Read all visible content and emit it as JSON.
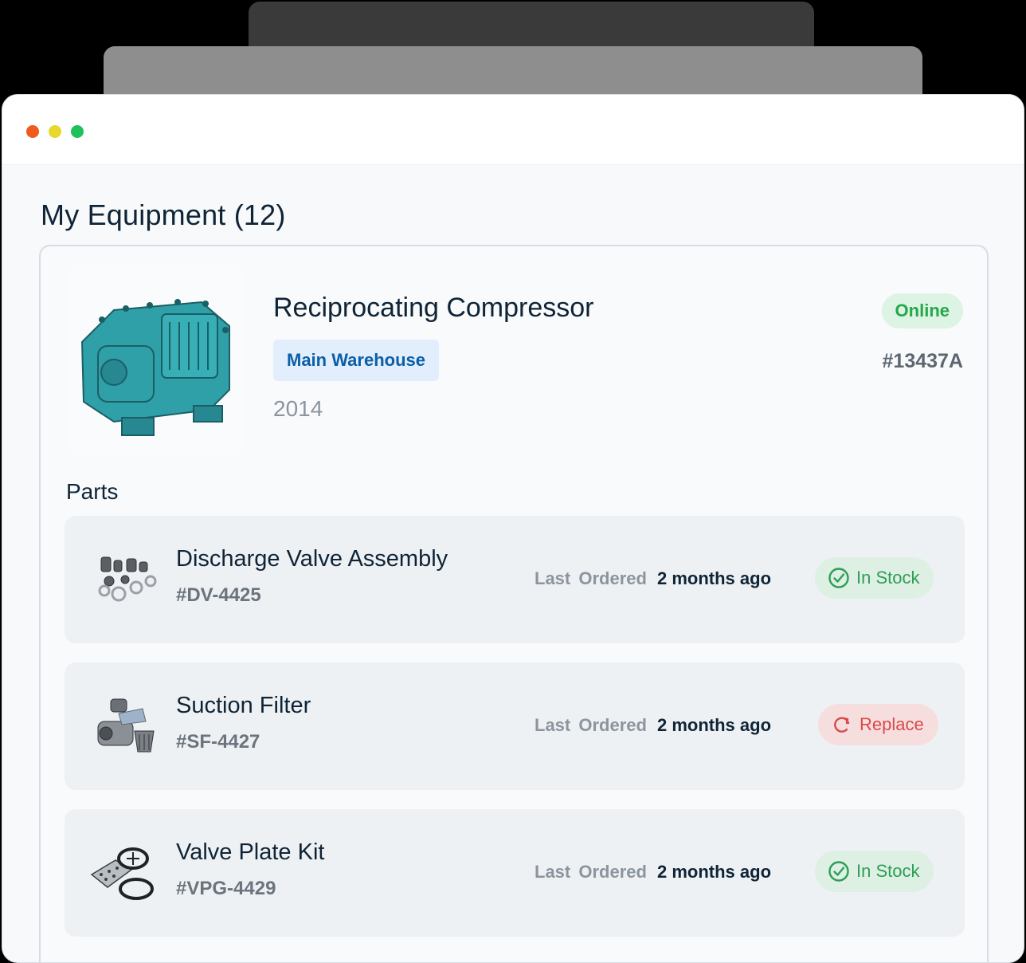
{
  "page": {
    "heading": "My Equipment (12)"
  },
  "equipment": {
    "name": "Reciprocating Compressor",
    "location": "Main Warehouse",
    "year": "2014",
    "status": "Online",
    "id": "#13437A",
    "image_icon": "compressor-image",
    "image_color": "#2f9fa8"
  },
  "parts_section": {
    "title": "Parts",
    "last_ordered_label": "Last Ordered",
    "items": [
      {
        "name": "Discharge Valve Assembly",
        "number": "#DV-4425",
        "last_ordered": "2 months ago",
        "status": "In Stock",
        "status_icon": "check-circle-icon"
      },
      {
        "name": "Suction Filter",
        "number": "#SF-4427",
        "last_ordered": "2 months ago",
        "status": "Replace",
        "status_icon": "refresh-icon"
      },
      {
        "name": "Valve Plate Kit",
        "number": "#VPG-4429",
        "last_ordered": "2 months ago",
        "status": "In Stock",
        "status_icon": "check-circle-icon"
      }
    ]
  },
  "colors": {
    "online_bg": "#ddf3e3",
    "online_text": "#24a84a",
    "replace_text": "#d94a4a",
    "location_text": "#0b5ea8"
  }
}
